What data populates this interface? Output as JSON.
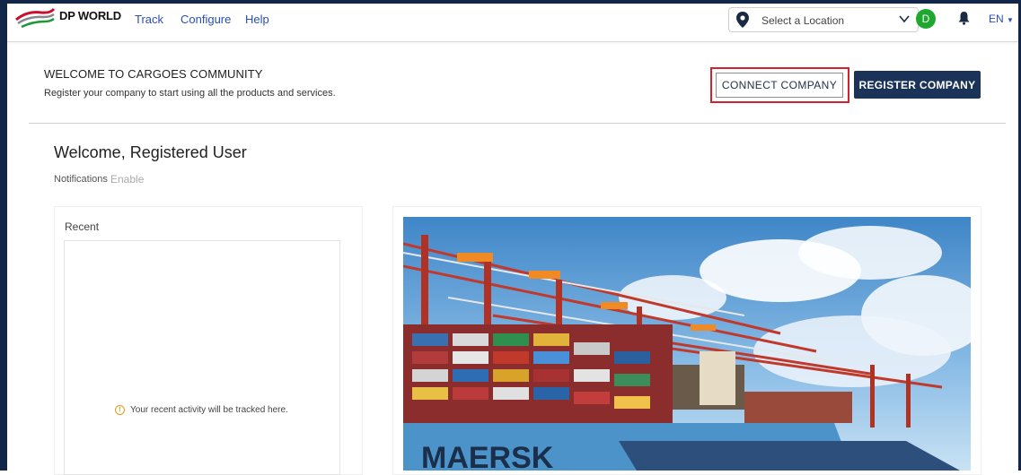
{
  "header": {
    "logo_text": "DP WORLD",
    "nav": [
      "Track",
      "Configure",
      "Help"
    ],
    "location_placeholder": "Select a Location",
    "avatar_initial": "D",
    "language": "EN"
  },
  "banner": {
    "title": "WELCOME TO CARGOES COMMUNITY",
    "subtitle": "Register your company to start using all the products and services.",
    "connect_label": "CONNECT COMPANY",
    "register_label": "REGISTER COMPANY"
  },
  "user": {
    "greeting": "Welcome, Registered User",
    "notifications_label": "Notifications",
    "enable_label": "Enable"
  },
  "recent": {
    "title": "Recent",
    "empty_message": "Your recent activity will be tracked here."
  },
  "hero": {
    "ship_text": "MAERSK"
  },
  "colors": {
    "brand_navy": "#1b3358",
    "link_blue": "#2a4fb0",
    "highlight_red": "#d2222d",
    "avatar_green": "#1fa830"
  }
}
